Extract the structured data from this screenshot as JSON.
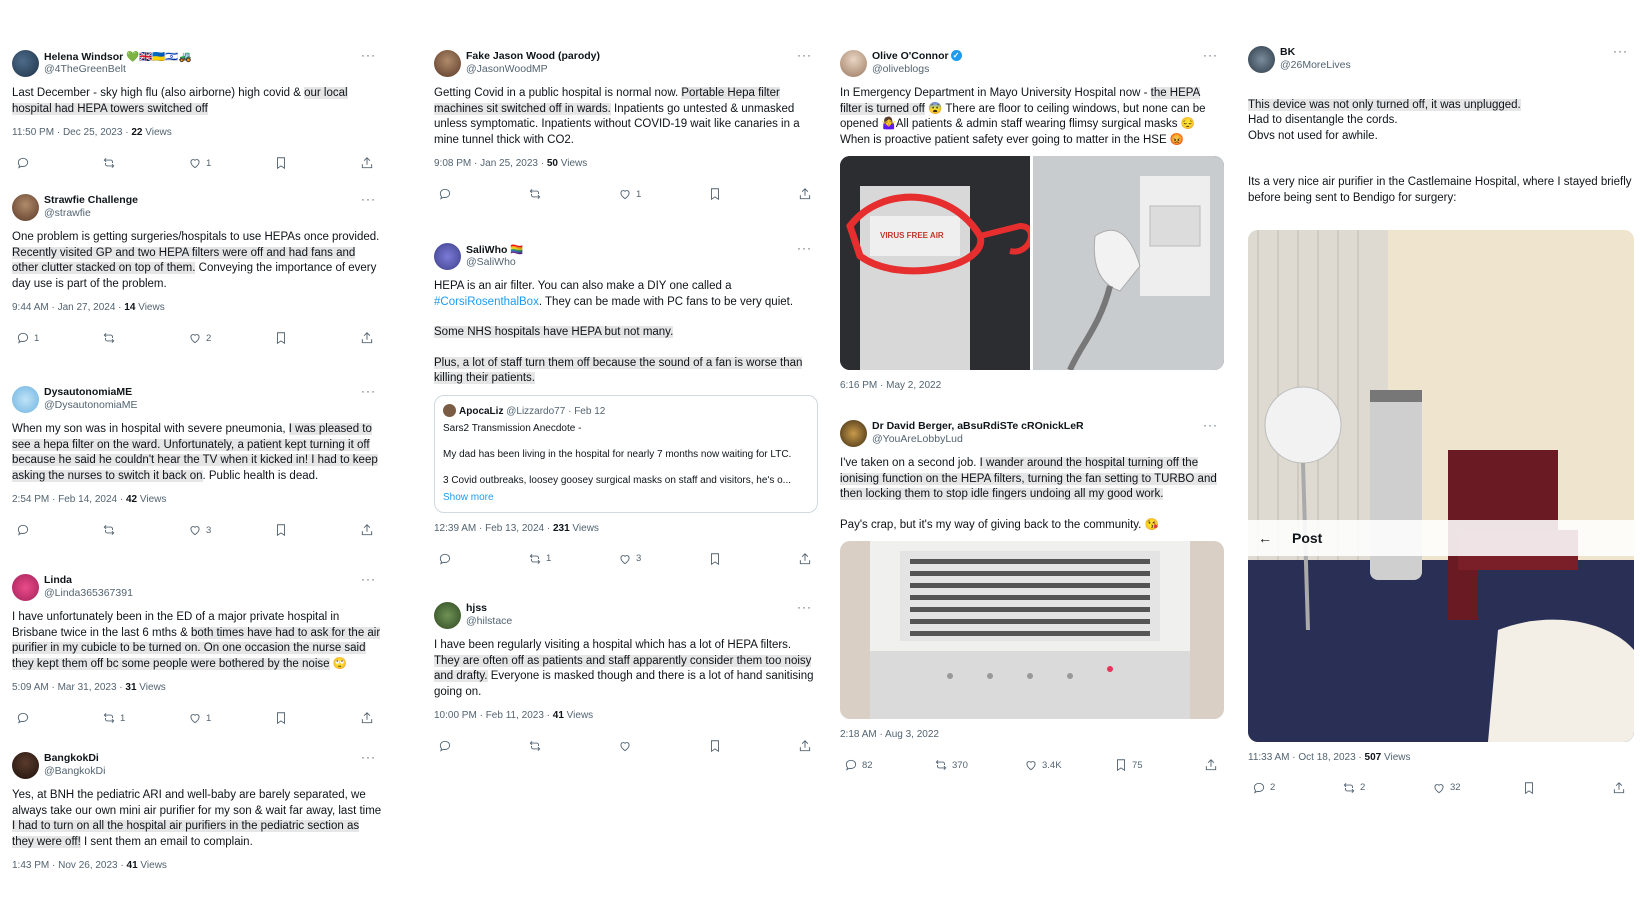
{
  "columns": [
    {
      "tweets": [
        {
          "name": "Helena Windsor 💚🇬🇧🇺🇦🇮🇱🚜",
          "handle": "@4TheGreenBelt",
          "text_parts": [
            {
              "t": "Last December - sky high flu (also airborne) high covid & ",
              "hl": false
            },
            {
              "t": "our local hospital had HEPA towers switched off",
              "hl": true
            }
          ],
          "time": "11:50 PM · Dec 25, 2023 · ",
          "views": "22",
          "views_label": " Views",
          "counts": {
            "reply": "",
            "retweet": "",
            "like": "1"
          }
        },
        {
          "name": "Strawfie Challenge",
          "handle": "@strawfie",
          "text_parts": [
            {
              "t": "One problem is getting surgeries/hospitals to use HEPAs once provided. ",
              "hl": false
            },
            {
              "t": "Recently visited GP and two HEPA filters were off and had fans and other clutter stacked on top of them.",
              "hl": true
            },
            {
              "t": " Conveying the importance of every day use is part of the problem.",
              "hl": false
            }
          ],
          "time": "9:44 AM · Jan 27, 2024 · ",
          "views": "14",
          "views_label": " Views",
          "counts": {
            "reply": "1",
            "retweet": "",
            "like": "2"
          }
        },
        {
          "name": "DysautonomiaME",
          "handle": "@DysautonomiaME",
          "text_parts": [
            {
              "t": "When my son was in hospital with severe pneumonia, ",
              "hl": false
            },
            {
              "t": "I was pleased to see a hepa filter on the ward. Unfortunately, a patient kept turning it off because he said he couldn't hear the TV when it kicked in! I had to keep asking the nurses to switch it back on",
              "hl": true
            },
            {
              "t": ". Public health is dead.",
              "hl": false
            }
          ],
          "time": "2:54 PM · Feb 14, 2024 · ",
          "views": "42",
          "views_label": " Views",
          "counts": {
            "reply": "",
            "retweet": "",
            "like": "3"
          }
        },
        {
          "name": "Linda",
          "handle": "@Linda365367391",
          "text_parts": [
            {
              "t": "I have unfortunately been in the ED of a major private hospital in Brisbane twice in the last 6 mths & ",
              "hl": false
            },
            {
              "t": "both times have had to ask for the air purifier in my cubicle to be turned on. On one occasion the nurse said they kept them off bc some people were bothered by the noise",
              "hl": true
            },
            {
              "t": " 🙄",
              "hl": false
            }
          ],
          "time": "5:09 AM · Mar 31, 2023 · ",
          "views": "31",
          "views_label": " Views",
          "counts": {
            "reply": "",
            "retweet": "1",
            "like": "1"
          }
        },
        {
          "name": "BangkokDi",
          "handle": "@BangkokDi",
          "text_parts": [
            {
              "t": "Yes, at BNH the pediatric ARI and well-baby are barely separated, we always take our own mini air purifier for my son & wait far away, last time ",
              "hl": false
            },
            {
              "t": "I had to turn on all the hospital air purifiers in the pediatric section as they were off!",
              "hl": true
            },
            {
              "t": " I sent them an email to complain.",
              "hl": false
            }
          ],
          "time": "1:43 PM · Nov 26, 2023 · ",
          "views": "41",
          "views_label": " Views",
          "counts": null
        }
      ]
    },
    {
      "tweets": [
        {
          "name": "Fake Jason Wood (parody)",
          "handle": "@JasonWoodMP",
          "text_parts": [
            {
              "t": "Getting Covid in a public hospital is normal now. ",
              "hl": false
            },
            {
              "t": "Portable Hepa filter machines sit switched off in wards.",
              "hl": true
            },
            {
              "t": " Inpatients go untested & unmasked unless symptomatic. Inpatients without COVID-19 wait like canaries in a mine tunnel thick with CO2.",
              "hl": false
            }
          ],
          "time": "9:08 PM · Jan 25, 2023 · ",
          "views": "50",
          "views_label": " Views",
          "counts": {
            "reply": "",
            "retweet": "",
            "like": "1"
          }
        },
        {
          "name": "SaliWho 🏳️‍🌈",
          "handle": "@SaliWho",
          "paras": [
            [
              {
                "t": "HEPA is an air filter. You can also make a DIY one called a ",
                "hl": false
              },
              {
                "t": "#CorsiRosenthalBox",
                "hl": false,
                "tag": true
              },
              {
                "t": ". They can be made with PC fans to be very quiet.",
                "hl": false
              }
            ],
            [
              {
                "t": "Some NHS hospitals have HEPA but not many.",
                "hl": true
              }
            ],
            [
              {
                "t": "Plus, a lot of staff turn them off because the sound of a fan is worse than killing their patients.",
                "hl": true
              }
            ]
          ],
          "quote": {
            "name": "ApocaLiz",
            "handle": "@Lizzardo77 · Feb 12",
            "line1": "Sars2 Transmission Anecdote -",
            "line2": "My dad has been living in the hospital for nearly 7 months now waiting for LTC.",
            "line3": "3 Covid outbreaks, loosey goosey surgical masks on staff and visitors, he's o...",
            "show_more": "Show more"
          },
          "time": "12:39 AM · Feb 13, 2024 · ",
          "views": "231",
          "views_label": " Views",
          "counts": {
            "reply": "",
            "retweet": "1",
            "like": "3"
          }
        },
        {
          "name": "hjss",
          "handle": "@hilstace",
          "text_parts": [
            {
              "t": "I have been regularly visiting a hospital which has a lot of HEPA filters. ",
              "hl": false
            },
            {
              "t": "They are often off as patients and staff apparently consider them too noisy and drafty.",
              "hl": true
            },
            {
              "t": " Everyone is masked though and there is a lot of hand sanitising going on.",
              "hl": false
            }
          ],
          "time": "10:00 PM · Feb 11, 2023 · ",
          "views": "41",
          "views_label": " Views",
          "counts": {
            "reply": "",
            "retweet": "",
            "like": ""
          }
        }
      ]
    },
    {
      "tweets": [
        {
          "name": "Olive O'Connor",
          "handle": "@oliveblogs",
          "text_parts": [
            {
              "t": "In Emergency Department in Mayo University Hospital now - ",
              "hl": false
            },
            {
              "t": "the HEPA filter is turned off",
              "hl": true
            },
            {
              "t": " 😨 There are floor to ceiling windows, but none can be opened 🤷‍♀️All patients & admin staff wearing flimsy surgical masks 😔 When is proactive patient safety ever going to matter in the HSE 😡",
              "hl": false
            }
          ],
          "image_label": "VIRUS FREE AIR",
          "time": "6:16 PM · May 2, 2022",
          "views": "",
          "views_label": "",
          "counts": null
        },
        {
          "name": "Dr David Berger, aBsuRdiSTe cROnickLeR",
          "handle": "@YouAreLobbyLud",
          "paras": [
            [
              {
                "t": "I've taken on a second job. ",
                "hl": false
              },
              {
                "t": "I wander around the hospital turning off the ionising function on the HEPA filters, turning the fan setting to TURBO and then locking them to stop idle fingers undoing all my good work.",
                "hl": true
              }
            ],
            [
              {
                "t": "Pay's crap, but it's my way of giving back to the community. 😘",
                "hl": false
              }
            ]
          ],
          "time": "2:18 AM · Aug 3, 2022",
          "views": "",
          "views_label": "",
          "counts": {
            "reply": "82",
            "retweet": "370",
            "like": "3.4K",
            "bookmark": "75"
          }
        }
      ]
    },
    {
      "tweets": [
        {
          "name": "BK",
          "handle": "@26MoreLives",
          "paras": [
            [
              {
                "t": "This device was not only turned off, it was unplugged.",
                "hl": true
              },
              {
                "t": "\nHad to disentangle the cords.\nObvs not used for awhile.",
                "hl": false
              }
            ],
            [
              {
                "t": "Its a very nice air purifier in the Castlemaine Hospital, where I stayed briefly before being sent to Bendigo for surgery:",
                "hl": false
              }
            ]
          ],
          "post_bar": {
            "back": "←",
            "label": "Post"
          },
          "time": "11:33 AM · Oct 18, 2023 · ",
          "views": "507",
          "views_label": " Views",
          "counts": {
            "reply": "2",
            "retweet": "2",
            "like": "32"
          }
        }
      ]
    }
  ],
  "icons": {
    "reply": "reply-icon",
    "retweet": "retweet-icon",
    "like": "heart-icon",
    "bookmark": "bookmark-icon",
    "share": "share-icon",
    "more": "more-icon",
    "verified": "verified-badge-icon"
  },
  "colors": {
    "highlight": "#e6e6e6",
    "link": "#1d9bf0",
    "muted": "#536471",
    "text": "#0f1419"
  },
  "more_glyph": "···",
  "verified_glyph": "✓"
}
